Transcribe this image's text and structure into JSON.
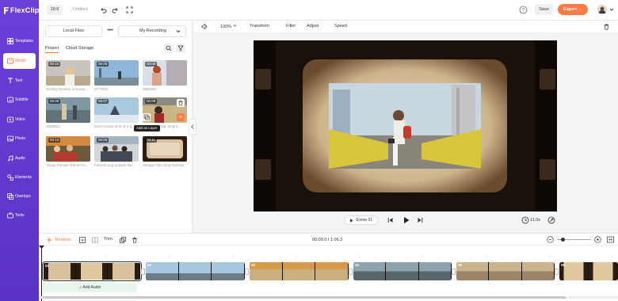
{
  "app": {
    "logo_text": "FlexClip"
  },
  "topbar": {
    "ratio": "16:9",
    "project_name": "Untitled",
    "save_label": "Save",
    "export_label": "Export →"
  },
  "sidebar": {
    "items": [
      {
        "label": "Templates",
        "icon": "templates-icon"
      },
      {
        "label": "Media",
        "icon": "media-icon",
        "active": true
      },
      {
        "label": "Text",
        "icon": "text-icon"
      },
      {
        "label": "Subtitle",
        "icon": "subtitle-icon"
      },
      {
        "label": "Video",
        "icon": "video-icon"
      },
      {
        "label": "Photo",
        "icon": "photo-icon"
      },
      {
        "label": "Audio",
        "icon": "audio-icon"
      },
      {
        "label": "Elements",
        "icon": "elements-icon"
      },
      {
        "label": "Overlays",
        "icon": "overlays-icon"
      },
      {
        "label": "Tools",
        "icon": "tools-icon"
      }
    ]
  },
  "panel": {
    "local_files": "Local Files",
    "more": "•••",
    "recording": "My Recording",
    "tabs": [
      "Project",
      "Cloud Storage"
    ],
    "add_layer_tooltip": "Add as Layer",
    "media": [
      {
        "duration": "00:15",
        "caption": "Smiling Woman in Europ..."
      },
      {
        "duration": "00:09",
        "caption": "3773275"
      },
      {
        "duration": "00:08",
        "caption": "3062091"
      },
      {
        "duration": "00:09",
        "caption": "3189812"
      },
      {
        "duration": "00:07",
        "caption": "Slow-motion shot of a g..."
      },
      {
        "duration": "00:09",
        "caption": "Girl in red coat, long h..."
      },
      {
        "duration": "00:14",
        "caption": "Young Female Teens Fro..."
      },
      {
        "duration": "00:05",
        "caption": "Friends sing outside the..."
      },
      {
        "duration": "00:11",
        "caption": "Vintage Film Strip Overlay"
      }
    ]
  },
  "editor": {
    "zoom": "100%",
    "tools": [
      "Transform",
      "Filter",
      "Adjust",
      "Speed"
    ]
  },
  "preview": {
    "scene_label": "Scene 01",
    "duration": "11.0s"
  },
  "timeline": {
    "label": "Timeline",
    "trim": "Trim",
    "time": "00:00.0 / 1:06.3",
    "add_audio": "Add Audio",
    "clips": [
      "01",
      "02",
      "03",
      "04",
      "05",
      "06",
      "07"
    ]
  }
}
